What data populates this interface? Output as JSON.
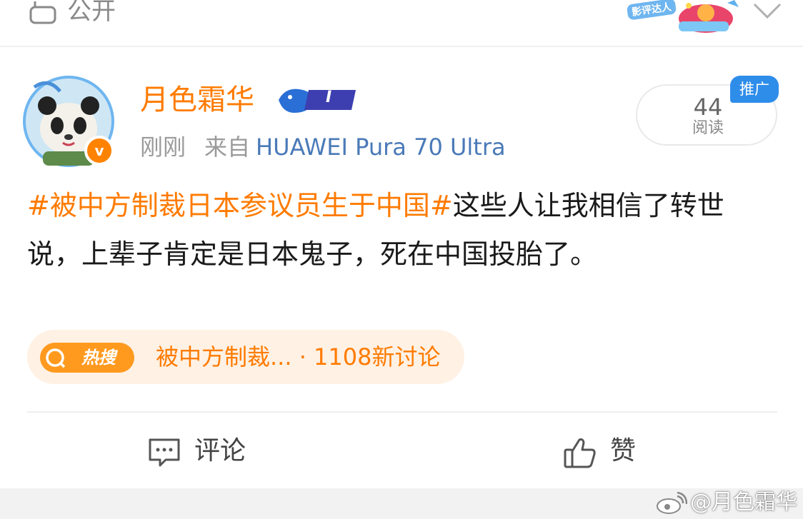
{
  "top": {
    "visibility_label": "公开",
    "badge_text": "影评达人",
    "icons": [
      "lock-icon",
      "chevron-down-icon"
    ]
  },
  "post": {
    "username": "月色霜华",
    "level": "I",
    "verified_mark": "v",
    "time": "刚刚",
    "from_label": "来自",
    "device": "HUAWEI Pura 70 Ultra",
    "reads_count": "44",
    "reads_label": "阅读",
    "promo_tag": "推广",
    "hashtag": "#被中方制裁日本参议员生于中国#",
    "body": "这些人让我相信了转世说，上辈子肯定是日本鬼子，死在中国投胎了。",
    "hot_search": {
      "label": "热搜",
      "text": "被中方制裁... · 1108新讨论"
    },
    "actions": {
      "comment_label": "评论",
      "like_label": "赞"
    }
  },
  "watermark": "@月色霜华",
  "colors": {
    "accent_orange": "#ff7b00",
    "link_blue": "#4a7ab8",
    "promo_blue": "#2f8dea",
    "hot_bg": "#fff1e4"
  }
}
